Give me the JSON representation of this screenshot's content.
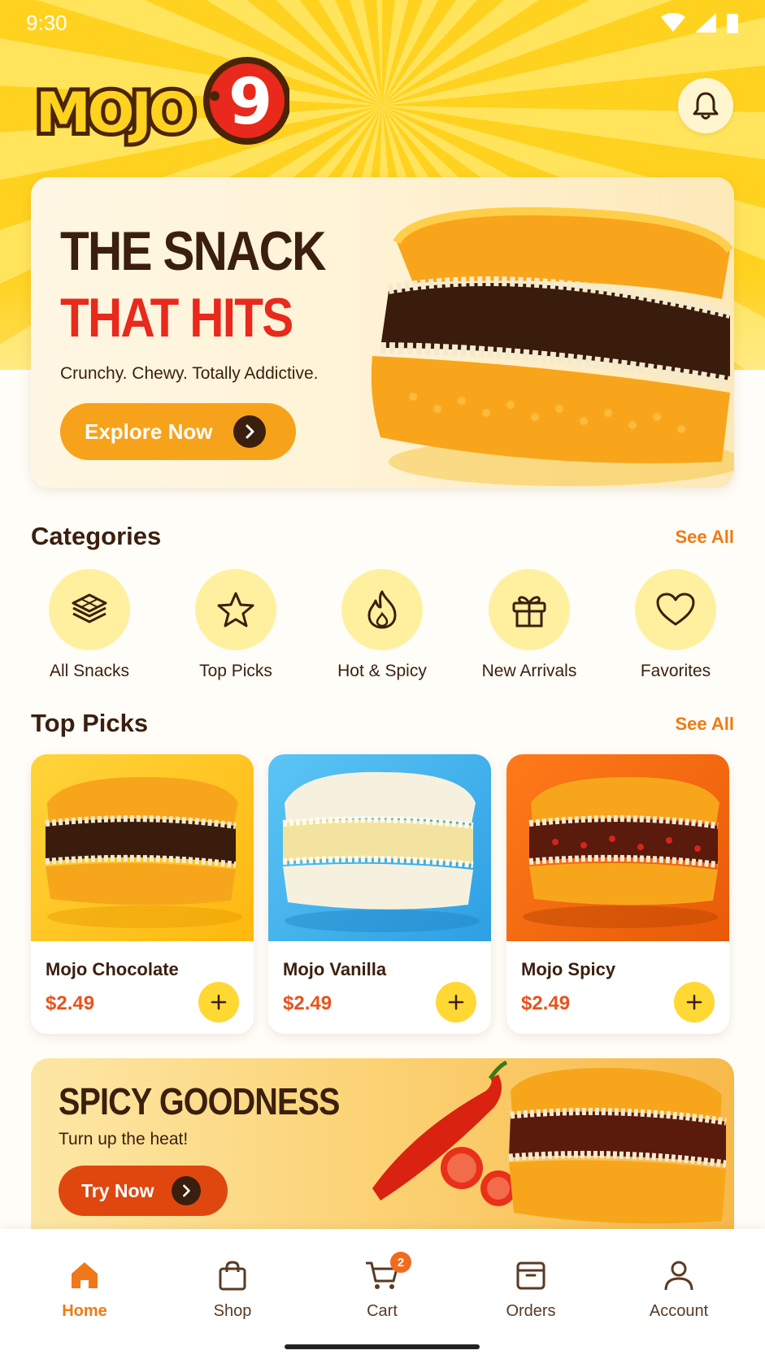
{
  "status_bar": {
    "time": "9:30"
  },
  "brand": {
    "logo_text": "MOJO9"
  },
  "hero": {
    "headline_1": "THE SNACK",
    "headline_2": "THAT HITS",
    "subtitle": "Crunchy. Chewy. Totally Addictive.",
    "cta_label": "Explore Now"
  },
  "categories": {
    "title": "Categories",
    "see_all": "See All",
    "items": [
      {
        "label": "All Snacks",
        "icon": "waffle-stack-icon"
      },
      {
        "label": "Top Picks",
        "icon": "star-icon"
      },
      {
        "label": "Hot & Spicy",
        "icon": "flame-icon"
      },
      {
        "label": "New Arrivals",
        "icon": "gift-icon"
      },
      {
        "label": "Favorites",
        "icon": "heart-icon"
      }
    ]
  },
  "top_picks": {
    "title": "Top Picks",
    "see_all": "See All",
    "products": [
      {
        "name": "Mojo Chocolate",
        "price": "$2.49",
        "bg_color": "#ffc21a"
      },
      {
        "name": "Mojo Vanilla",
        "price": "$2.49",
        "bg_color": "#49b6ee"
      },
      {
        "name": "Mojo Spicy",
        "price": "$2.49",
        "bg_color": "#f26a12"
      }
    ]
  },
  "promo": {
    "title": "SPICY GOODNESS",
    "subtitle": "Turn up the heat!",
    "cta_label": "Try Now"
  },
  "bottom_nav": {
    "items": [
      {
        "label": "Home",
        "icon": "home-icon",
        "active": true
      },
      {
        "label": "Shop",
        "icon": "shopping-bag-icon",
        "active": false
      },
      {
        "label": "Cart",
        "icon": "cart-icon",
        "active": false,
        "badge": "2"
      },
      {
        "label": "Orders",
        "icon": "orders-box-icon",
        "active": false
      },
      {
        "label": "Account",
        "icon": "user-icon",
        "active": false
      }
    ]
  },
  "colors": {
    "accent_orange": "#ef7b12",
    "brown_text": "#3b1f0e",
    "red_headline": "#e8291c",
    "yellow_circle": "#fff0a0"
  }
}
